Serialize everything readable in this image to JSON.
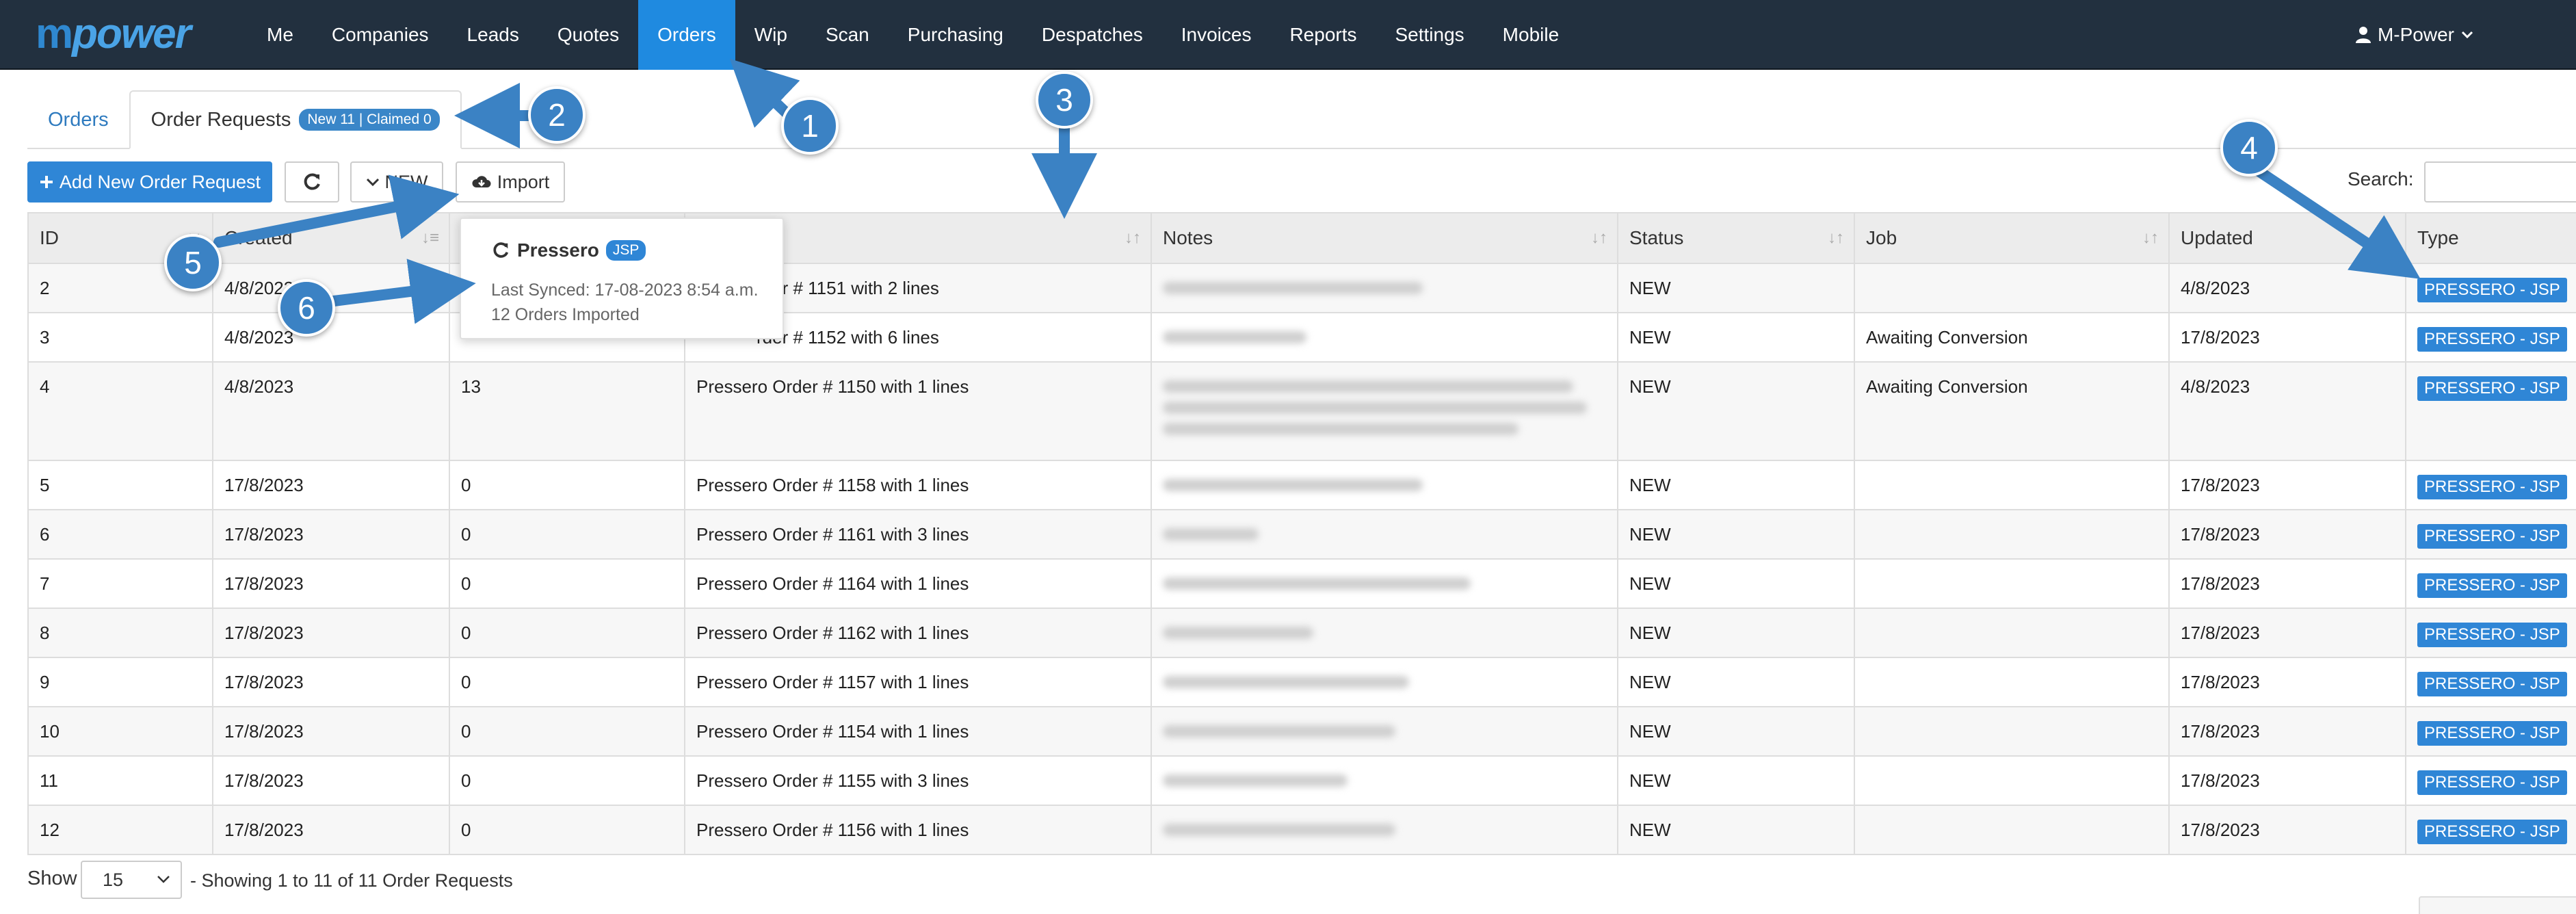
{
  "brand": {
    "m": "m",
    "rest": "power"
  },
  "nav": {
    "items": [
      "Me",
      "Companies",
      "Leads",
      "Quotes",
      "Orders",
      "Wip",
      "Scan",
      "Purchasing",
      "Despatches",
      "Invoices",
      "Reports",
      "Settings",
      "Mobile"
    ],
    "active": "Orders",
    "user": "M-Power"
  },
  "tabs": {
    "orders": "Orders",
    "order_requests": "Order Requests",
    "badge": "New 11 | Claimed 0"
  },
  "toolbar": {
    "add": "Add New Order Request",
    "filter": "NEW",
    "import": "Import",
    "search_label": "Search:"
  },
  "table": {
    "headers": [
      "ID",
      "Created",
      "",
      "",
      "Notes",
      "Status",
      "Job",
      "Updated",
      "Type"
    ],
    "rows": [
      {
        "id": "2",
        "created": "4/8/2023",
        "count": "",
        "desc": "rder # 1151 with 2 lines",
        "status": "NEW",
        "job": "",
        "updated": "4/8/2023",
        "type": "PRESSERO - JSP"
      },
      {
        "id": "3",
        "created": "4/8/2023",
        "count": "",
        "desc": "rder # 1152 with 6 lines",
        "status": "NEW",
        "job": "Awaiting Conversion",
        "updated": "17/8/2023",
        "type": "PRESSERO - JSP"
      },
      {
        "id": "4",
        "created": "4/8/2023",
        "count": "13",
        "desc": "Pressero Order # 1150 with 1 lines",
        "status": "NEW",
        "job": "Awaiting Conversion",
        "updated": "4/8/2023",
        "type": "PRESSERO - JSP"
      },
      {
        "id": "5",
        "created": "17/8/2023",
        "count": "0",
        "desc": "Pressero Order # 1158 with 1 lines",
        "status": "NEW",
        "job": "",
        "updated": "17/8/2023",
        "type": "PRESSERO - JSP"
      },
      {
        "id": "6",
        "created": "17/8/2023",
        "count": "0",
        "desc": "Pressero Order # 1161 with 3 lines",
        "status": "NEW",
        "job": "",
        "updated": "17/8/2023",
        "type": "PRESSERO - JSP"
      },
      {
        "id": "7",
        "created": "17/8/2023",
        "count": "0",
        "desc": "Pressero Order # 1164 with 1 lines",
        "status": "NEW",
        "job": "",
        "updated": "17/8/2023",
        "type": "PRESSERO - JSP"
      },
      {
        "id": "8",
        "created": "17/8/2023",
        "count": "0",
        "desc": "Pressero Order # 1162 with 1 lines",
        "status": "NEW",
        "job": "",
        "updated": "17/8/2023",
        "type": "PRESSERO - JSP"
      },
      {
        "id": "9",
        "created": "17/8/2023",
        "count": "0",
        "desc": "Pressero Order # 1157 with 1 lines",
        "status": "NEW",
        "job": "",
        "updated": "17/8/2023",
        "type": "PRESSERO - JSP"
      },
      {
        "id": "10",
        "created": "17/8/2023",
        "count": "0",
        "desc": "Pressero Order # 1154 with 1 lines",
        "status": "NEW",
        "job": "",
        "updated": "17/8/2023",
        "type": "PRESSERO - JSP"
      },
      {
        "id": "11",
        "created": "17/8/2023",
        "count": "0",
        "desc": "Pressero Order # 1155 with 3 lines",
        "status": "NEW",
        "job": "",
        "updated": "17/8/2023",
        "type": "PRESSERO - JSP"
      },
      {
        "id": "12",
        "created": "17/8/2023",
        "count": "0",
        "desc": "Pressero Order # 1156 with 1 lines",
        "status": "NEW",
        "job": "",
        "updated": "17/8/2023",
        "type": "PRESSERO - JSP"
      }
    ]
  },
  "popover": {
    "title": "Pressero",
    "badge": "JSP",
    "synced": "Last Synced: 17-08-2023 8:54 a.m.",
    "imported": "12 Orders Imported"
  },
  "footer": {
    "show": "Show",
    "page_size": "15",
    "showing": "- Showing 1 to 11 of 11 Order Requests"
  },
  "callouts": [
    "1",
    "2",
    "3",
    "4",
    "5",
    "6"
  ],
  "colors": {
    "navbar": "#22303f",
    "accent": "#2f86d6",
    "callout": "#3b82c4"
  }
}
